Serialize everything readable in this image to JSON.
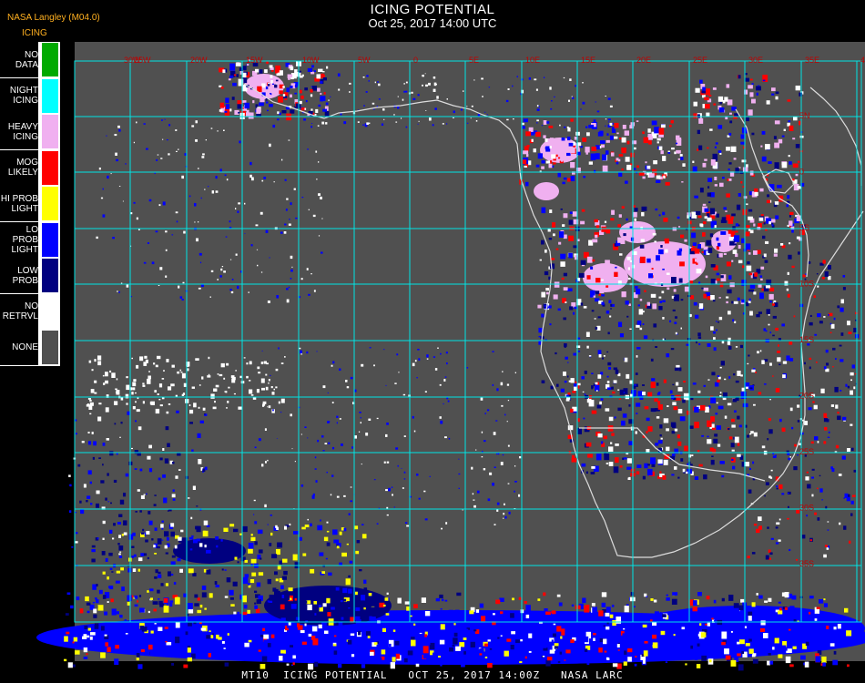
{
  "header": {
    "title": "ICING POTENTIAL",
    "subtitle": "Oct 25, 2017 14:00 UTC",
    "product": "NASA Langley (M04.0)",
    "param": "ICING"
  },
  "legend": [
    {
      "label": [
        "NO DATA"
      ],
      "color": "#00aa00"
    },
    {
      "label": [
        "NIGHT",
        "ICING"
      ],
      "color": "#00ffff"
    },
    {
      "label": [
        "HEAVY",
        "ICING"
      ],
      "color": "#f0b0f0"
    },
    {
      "label": [
        "MOG",
        "LIKELY"
      ],
      "color": "#ff0000"
    },
    {
      "label": [
        "HI PROB",
        "LIGHT"
      ],
      "color": "#ffff00"
    },
    {
      "label": [
        "LO PROB",
        "LIGHT"
      ],
      "color": "#0000ff"
    },
    {
      "label": [
        "LOW",
        "PROB"
      ],
      "color": "#000080"
    },
    {
      "label": [
        "NO",
        "RETRVL"
      ],
      "color": "#ffffff"
    },
    {
      "label": [
        "NONE"
      ],
      "color": "#505050"
    }
  ],
  "grid": {
    "top_labels": [
      "30W",
      "25W",
      "20W",
      "15W",
      "10W",
      "5W",
      "0",
      "5E",
      "10E",
      "15E",
      "20E",
      "25E",
      "30E",
      "35E",
      "40E"
    ],
    "right_labels": [
      "5N",
      "0",
      "5S",
      "10S",
      "15S",
      "20S",
      "25S",
      "30S",
      "35S"
    ]
  },
  "colors": {
    "background": "#505050",
    "grid": "#00e5e5",
    "coast": "#dcdcdc",
    "grid_label": "#c00000"
  },
  "footer": "MT10  ICING POTENTIAL   OCT 25, 2017 14:00Z   NASA LARC"
}
